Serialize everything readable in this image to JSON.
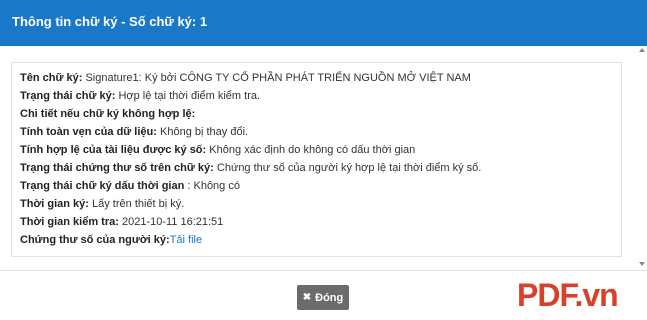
{
  "header": {
    "title": "Thông tin chữ ký - Số chữ ký: 1"
  },
  "details": [
    {
      "label": "Tên chữ ký",
      "sep": ": ",
      "value": "Signature1: Ký bởi CÔNG TY CỔ PHẦN PHÁT TRIỂN NGUỒN MỞ VIỆT NAM"
    },
    {
      "label": "Trạng thái chữ ký",
      "sep": ": ",
      "value": "Hợp lệ tại thời điểm kiểm tra."
    },
    {
      "label": "Chi tiết nếu chữ ký không hợp lệ:",
      "sep": "",
      "value": ""
    },
    {
      "label": "Tính toàn vẹn của dữ liệu",
      "sep": ": ",
      "value": "Không bị thay đổi."
    },
    {
      "label": "Tính hợp lệ của tài liệu được ký số",
      "sep": ": ",
      "value": "Không xác định do không có dấu thời gian"
    },
    {
      "label": "Trạng thái chứng thư số trên chữ ký",
      "sep": ": ",
      "value": "Chứng thư số của người ký hợp lệ tại thời điểm ký số."
    },
    {
      "label": "Trạng thái chữ ký dấu thời gian",
      "sep": " : ",
      "value": "Không có"
    },
    {
      "label": "Thời gian ký",
      "sep": ": ",
      "value": "Lấy trên thiết bị ký."
    },
    {
      "label": "Thời gian kiểm tra",
      "sep": ": ",
      "value": "2021-10-11 16:21:51"
    },
    {
      "label": "Chứng thư số của người ký:",
      "sep": "",
      "value": "",
      "link": "Tải file"
    }
  ],
  "footer": {
    "close_label": "Đóng",
    "close_icon": "close-icon"
  },
  "watermark": "PDF.vn",
  "colors": {
    "header": "#1a78c8",
    "button": "#6b6b6b",
    "link": "#1a78c8",
    "watermark": "#d8402a"
  }
}
